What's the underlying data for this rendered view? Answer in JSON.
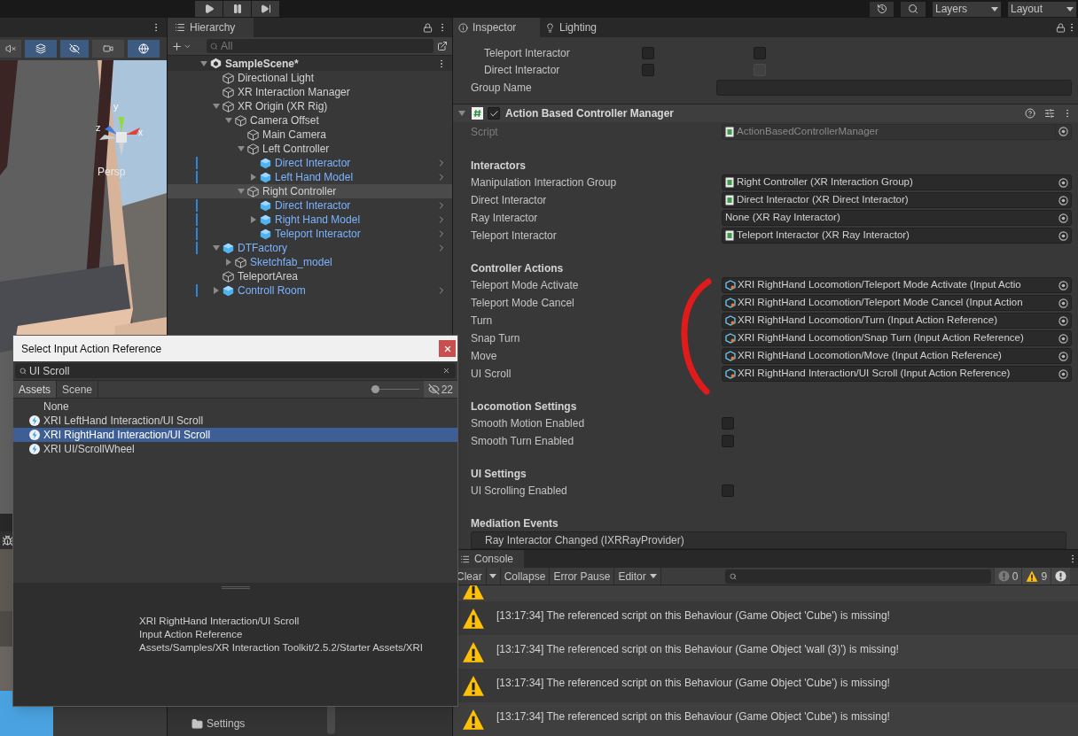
{
  "toolbar": {
    "layers": "Layers",
    "layout": "Layout"
  },
  "scene_view": {
    "view_label": "Persp",
    "gizmo_axes": [
      "y",
      "z",
      "x"
    ],
    "toggles": [
      {
        "kind": "audio",
        "on": false
      },
      {
        "kind": "gizmo",
        "on": true
      },
      {
        "kind": "visibility",
        "on": true
      },
      {
        "kind": "camera",
        "on": false
      },
      {
        "kind": "gizmos",
        "on": true
      }
    ]
  },
  "hierarchy": {
    "title": "Hierarchy",
    "search": {
      "placeholder": "All"
    },
    "scene": {
      "label": "SampleScene*",
      "expanded": true
    },
    "items": [
      {
        "label": "Directional Light",
        "kind": "object",
        "selected": false
      },
      {
        "label": "XR Interaction Manager",
        "kind": "object",
        "selected": false
      },
      {
        "label": "XR Origin (XR Rig)",
        "kind": "object",
        "expanded": true,
        "selected": false,
        "children": [
          {
            "label": "Camera Offset",
            "kind": "object",
            "expanded": true,
            "selected": false,
            "children": [
              {
                "label": "Main Camera",
                "kind": "object",
                "selected": false
              },
              {
                "label": "Left Controller",
                "kind": "object",
                "expanded": true,
                "selected": false,
                "children": [
                  {
                    "label": "Direct Interactor",
                    "kind": "prefab",
                    "selected": false
                  },
                  {
                    "label": "Left Hand Model",
                    "kind": "prefab",
                    "expanded": false,
                    "selected": false
                  }
                ]
              },
              {
                "label": "Right Controller",
                "kind": "object",
                "expanded": true,
                "selected": true,
                "children": [
                  {
                    "label": "Direct Interactor",
                    "kind": "prefab",
                    "selected": false
                  },
                  {
                    "label": "Right Hand Model",
                    "kind": "prefab",
                    "expanded": false,
                    "selected": false
                  },
                  {
                    "label": "Teleport Interactor",
                    "kind": "prefab",
                    "selected": false
                  }
                ]
              }
            ]
          }
        ]
      },
      {
        "label": "DTFactory",
        "kind": "prefab",
        "expanded": true,
        "selected": false,
        "children": [
          {
            "label": "Sketchfab_model",
            "kind": "prefab-child",
            "expanded": false,
            "selected": false
          }
        ]
      },
      {
        "label": "TeleportArea",
        "kind": "object",
        "selected": false
      },
      {
        "label": "Controll Room",
        "kind": "prefab",
        "expanded": false,
        "selected": false
      }
    ]
  },
  "project": {
    "folders": [
      {
        "label": "Settings"
      }
    ]
  },
  "inspector": {
    "tabs": [
      {
        "label": "Inspector",
        "selected": true
      },
      {
        "label": "Lighting",
        "selected": false
      }
    ],
    "override_rows": [
      {
        "label": "Teleport Interactor",
        "overrides": [
          {
            "checked": false,
            "disabled": false
          },
          {
            "checked": false,
            "disabled": false
          }
        ]
      },
      {
        "label": "Direct Interactor",
        "overrides": [
          {
            "checked": false,
            "disabled": false
          },
          {
            "checked": false,
            "disabled": true
          }
        ]
      }
    ],
    "group_name": {
      "label": "Group Name"
    },
    "component": {
      "title": "Action Based Controller Manager",
      "enabled": true,
      "script": {
        "label": "Script",
        "value": "ActionBasedControllerManager"
      },
      "sections": [
        {
          "heading": "Interactors",
          "fields": [
            {
              "kind": "object",
              "label": "Manipulation Interaction Group",
              "value": "Right Controller (XR Interaction Group)",
              "assigned": true
            },
            {
              "kind": "object",
              "label": "Direct Interactor",
              "value": "Direct Interactor (XR Direct Interactor)",
              "assigned": true
            },
            {
              "kind": "object",
              "label": "Ray Interactor",
              "value": "None (XR Ray Interactor)",
              "assigned": false
            },
            {
              "kind": "object",
              "label": "Teleport Interactor",
              "value": "Teleport Interactor (XR Ray Interactor)",
              "assigned": true
            }
          ]
        },
        {
          "heading": "Controller Actions",
          "fields": [
            {
              "kind": "action",
              "label": "Teleport Mode Activate",
              "value": "XRI RightHand Locomotion/Teleport Mode Activate (Input Actio"
            },
            {
              "kind": "action",
              "label": "Teleport Mode Cancel",
              "value": "XRI RightHand Locomotion/Teleport Mode Cancel (Input Action"
            },
            {
              "kind": "action",
              "label": "Turn",
              "value": "XRI RightHand Locomotion/Turn (Input Action Reference)"
            },
            {
              "kind": "action",
              "label": "Snap Turn",
              "value": "XRI RightHand Locomotion/Snap Turn (Input Action Reference)"
            },
            {
              "kind": "action",
              "label": "Move",
              "value": "XRI RightHand Locomotion/Move (Input Action Reference)"
            },
            {
              "kind": "action",
              "label": "UI Scroll",
              "value": "XRI RightHand Interaction/UI Scroll (Input Action Reference)"
            }
          ]
        },
        {
          "heading": "Locomotion Settings",
          "fields": [
            {
              "kind": "toggle",
              "label": "Smooth Motion Enabled",
              "checked": false
            },
            {
              "kind": "toggle",
              "label": "Smooth Turn Enabled",
              "checked": false
            }
          ]
        },
        {
          "heading": "UI Settings",
          "fields": [
            {
              "kind": "toggle",
              "label": "UI Scrolling Enabled",
              "checked": false
            }
          ]
        },
        {
          "heading": "Mediation Events",
          "fields": [
            {
              "kind": "event",
              "value": "Ray Interactor Changed (IXRRayProvider)"
            }
          ]
        }
      ]
    }
  },
  "console": {
    "title": "Console",
    "buttons": [
      "Clear",
      "Collapse",
      "Error Pause"
    ],
    "source": "Editor",
    "counters": [
      {
        "kind": "info",
        "count": "0"
      },
      {
        "kind": "warning",
        "count": "9"
      },
      {
        "kind": "error"
      }
    ],
    "messages": [
      {
        "kind": "warning"
      },
      {
        "kind": "warning",
        "text": "[13:17:34] The referenced script on this Behaviour (Game Object 'Cube') is missing!"
      },
      {
        "kind": "warning",
        "text": "[13:17:34] The referenced script on this Behaviour (Game Object 'wall (3)') is missing!"
      },
      {
        "kind": "warning",
        "text": "[13:17:34] The referenced script on this Behaviour (Game Object 'Cube') is missing!"
      },
      {
        "kind": "warning",
        "text": "[13:17:34] The referenced script on this Behaviour (Game Object 'Cube') is missing!"
      }
    ]
  },
  "dialog": {
    "title": "Select Input Action Reference",
    "search": {
      "value": "UI Scroll"
    },
    "tabs": [
      {
        "label": "Assets",
        "selected": true
      },
      {
        "label": "Scene",
        "selected": false
      }
    ],
    "zoom": {
      "level": 0.05
    },
    "hidden_count": "22",
    "items": [
      {
        "label": "None",
        "kind": "none",
        "selected": false
      },
      {
        "label": "XRI LeftHand Interaction/UI Scroll",
        "kind": "action",
        "selected": false
      },
      {
        "label": "XRI RightHand Interaction/UI Scroll",
        "kind": "action",
        "selected": true
      },
      {
        "label": "XRI UI/ScrollWheel",
        "kind": "action",
        "selected": false
      }
    ],
    "preview": [
      "XRI RightHand Interaction/UI Scroll",
      "Input Action Reference",
      "Assets/Samples/XR Interaction Toolkit/2.5.2/Starter Assets/XRI"
    ]
  }
}
